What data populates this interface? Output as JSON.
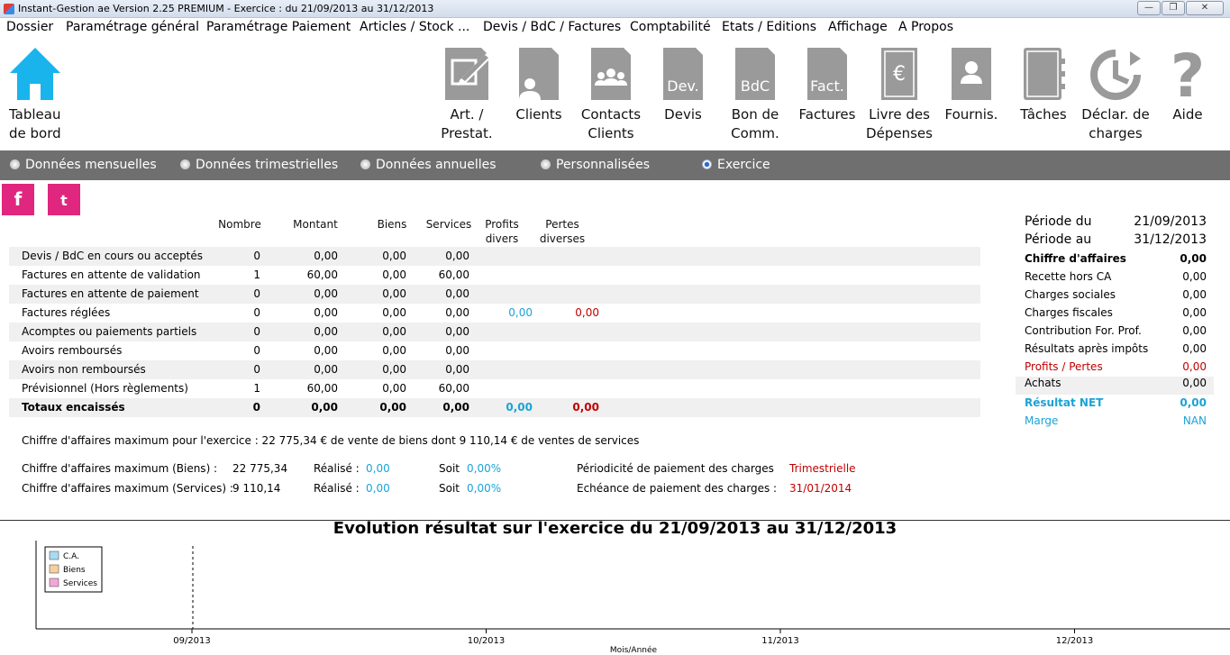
{
  "window": {
    "title": "Instant-Gestion ae Version 2.25 PREMIUM - Exercice : du 21/09/2013 au 31/12/2013",
    "minimize": "—",
    "restore": "❐",
    "close": "✕"
  },
  "menu": [
    "Dossier",
    "Paramétrage général",
    "Paramétrage Paiement",
    "Articles / Stock ...",
    "Devis / BdC / Factures",
    "Comptabilité",
    "Etats / Editions",
    "Affichage",
    "A Propos"
  ],
  "toolbar": {
    "home": "Tableau\nde bord",
    "items": [
      {
        "label": "Art. /\nPrestat.",
        "icon": "edit-document-icon"
      },
      {
        "label": "Clients",
        "icon": "client-document-icon"
      },
      {
        "label": "Contacts\nClients",
        "icon": "contacts-group-icon"
      },
      {
        "label": "Devis",
        "icon": "devis-document-icon",
        "badge": "Dev."
      },
      {
        "label": "Bon de\nComm.",
        "icon": "bdc-document-icon",
        "badge": "BdC"
      },
      {
        "label": "Factures",
        "icon": "factures-document-icon",
        "badge": "Fact."
      },
      {
        "label": "Livre des\nDépenses",
        "icon": "expenses-book-icon",
        "badge": "€"
      },
      {
        "label": "Fournis.",
        "icon": "supplier-icon"
      },
      {
        "label": "Tâches",
        "icon": "tasks-notebook-icon"
      },
      {
        "label": "Déclar. de\ncharges",
        "icon": "declaration-clock-icon"
      },
      {
        "label": "Aide",
        "icon": "help-question-icon",
        "badge": "?"
      }
    ]
  },
  "periods": {
    "monthly": "Données mensuelles",
    "quarterly": "Données trimestrielles",
    "annual": "Données annuelles",
    "custom": "Personnalisées",
    "exercise": "Exercice",
    "selected": "Exercice"
  },
  "social": {
    "facebook": "f",
    "twitter": "t"
  },
  "table": {
    "headers": {
      "nombre": "Nombre",
      "montant": "Montant",
      "biens": "Biens",
      "services": "Services",
      "profits": "Profits\ndivers",
      "pertes": "Pertes\ndiverses"
    },
    "rows": [
      {
        "label": "Devis / BdC en cours ou acceptés",
        "nombre": "0",
        "montant": "0,00",
        "biens": "0,00",
        "services": "0,00",
        "profits": "",
        "pertes": ""
      },
      {
        "label": "Factures en attente de validation",
        "nombre": "1",
        "montant": "60,00",
        "biens": "0,00",
        "services": "60,00",
        "profits": "",
        "pertes": ""
      },
      {
        "label": "Factures en attente de paiement",
        "nombre": "0",
        "montant": "0,00",
        "biens": "0,00",
        "services": "0,00",
        "profits": "",
        "pertes": ""
      },
      {
        "label": "Factures réglées",
        "nombre": "0",
        "montant": "0,00",
        "biens": "0,00",
        "services": "0,00",
        "profits": "0,00",
        "pertes": "0,00"
      },
      {
        "label": "Acomptes ou paiements partiels",
        "nombre": "0",
        "montant": "0,00",
        "biens": "0,00",
        "services": "0,00",
        "profits": "",
        "pertes": ""
      },
      {
        "label": "Avoirs remboursés",
        "nombre": "0",
        "montant": "0,00",
        "biens": "0,00",
        "services": "0,00",
        "profits": "",
        "pertes": ""
      },
      {
        "label": "Avoirs non remboursés",
        "nombre": "0",
        "montant": "0,00",
        "biens": "0,00",
        "services": "0,00",
        "profits": "",
        "pertes": ""
      },
      {
        "label": "Prévisionnel (Hors règlements)",
        "nombre": "1",
        "montant": "60,00",
        "biens": "0,00",
        "services": "60,00",
        "profits": "",
        "pertes": ""
      },
      {
        "label": "Totaux encaissés",
        "nombre": "0",
        "montant": "0,00",
        "biens": "0,00",
        "services": "0,00",
        "profits": "0,00",
        "pertes": "0,00"
      }
    ]
  },
  "summary": {
    "periode_du_label": "Période du",
    "periode_du": "21/09/2013",
    "periode_au_label": "Période au",
    "periode_au": "31/12/2013",
    "lines": [
      {
        "label": "Chiffre d'affaires",
        "value": "0,00",
        "style": "bold"
      },
      {
        "label": "Recette hors CA",
        "value": "0,00",
        "style": ""
      },
      {
        "label": "Charges sociales",
        "value": "0,00",
        "style": ""
      },
      {
        "label": "Charges fiscales",
        "value": "0,00",
        "style": ""
      },
      {
        "label": "Contribution For. Prof.",
        "value": "0,00",
        "style": ""
      },
      {
        "label": "Résultats après impôts",
        "value": "0,00",
        "style": ""
      },
      {
        "label": "Profits / Pertes",
        "value": "0,00",
        "style": "red"
      },
      {
        "label": "Achats",
        "value": "0,00",
        "style": "alt"
      },
      {
        "label": "Résultat NET",
        "value": "0,00",
        "style": "bluebold"
      },
      {
        "label": "Marge",
        "value": "NAN",
        "style": "blue"
      }
    ]
  },
  "info": {
    "max_ca": "Chiffre d'affaires maximum pour l'exercice : 22 775,34 € de vente de biens dont 9 110,14 € de ventes de services",
    "biens_label": "Chiffre d'affaires maximum (Biens) :",
    "biens_value": "22 775,34",
    "services_label": "Chiffre d'affaires maximum (Services) :",
    "services_value": "9 110,14",
    "realise_label": "Réalisé :",
    "realise_biens": "0,00",
    "realise_services": "0,00",
    "soit_label": "Soit",
    "soit_biens": "0,00%",
    "soit_services": "0,00%",
    "periodicite_label": "Périodicité de paiement des charges",
    "periodicite_value": "Trimestrielle",
    "echeance_label": "Echéance de paiement des charges :",
    "echeance_value": "31/01/2014"
  },
  "chart_data": {
    "type": "line",
    "title": "Evolution résultat sur l'exercice du 21/09/2013 au 31/12/2013",
    "xlabel": "Mois/Année",
    "ylabel": "",
    "categories": [
      "09/2013",
      "10/2013",
      "11/2013",
      "12/2013"
    ],
    "series": [
      {
        "name": "C.A.",
        "color": "#a8dcf0",
        "values": []
      },
      {
        "name": "Biens",
        "color": "#f7cf9e",
        "values": []
      },
      {
        "name": "Services",
        "color": "#f4a6d8",
        "values": []
      }
    ],
    "legend": "top-left",
    "grid": false
  }
}
